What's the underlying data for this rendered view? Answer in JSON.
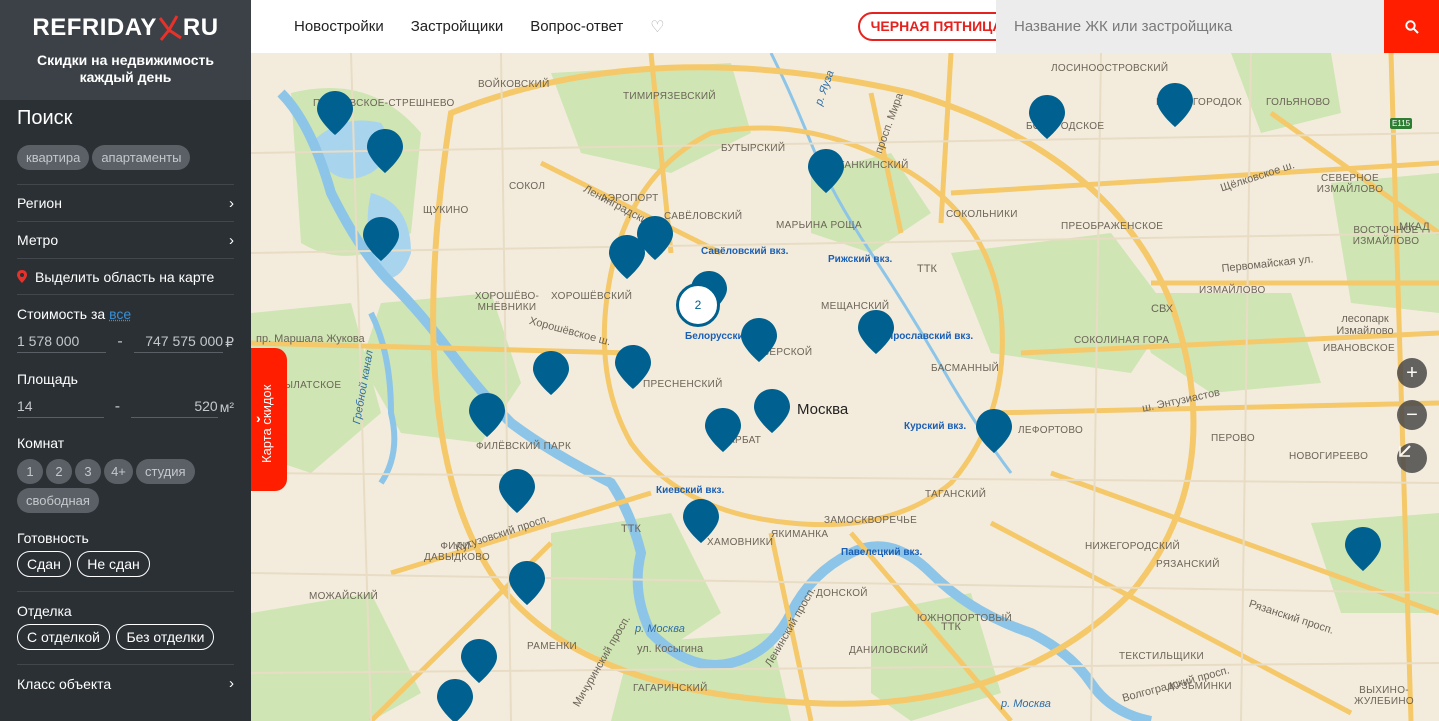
{
  "brand": {
    "logo_left": "REFRIDAY",
    "logo_right": "RU",
    "tagline": "Скидки на недвижимость каждый день"
  },
  "sidebar": {
    "title": "Поиск",
    "type_chips": [
      "квартира",
      "апартаменты"
    ],
    "region_label": "Регион",
    "metro_label": "Метро",
    "area_select_label": "Выделить область на карте",
    "price": {
      "label": "Стоимость за",
      "link": "все",
      "min": "1 578 000",
      "max": "747 575 000",
      "currency": "₽"
    },
    "area": {
      "label": "Площадь",
      "min": "14",
      "max": "520",
      "unit": "м²"
    },
    "rooms": {
      "label": "Комнат",
      "options": [
        "1",
        "2",
        "3",
        "4+"
      ],
      "extra": [
        "студия",
        "свободная"
      ]
    },
    "readiness": {
      "label": "Готовность",
      "options": [
        "Сдан",
        "Не сдан"
      ]
    },
    "finish": {
      "label": "Отделка",
      "options": [
        "С отделкой",
        "Без отделки"
      ]
    },
    "class_label": "Класс объекта"
  },
  "header": {
    "nav": [
      "Новостройки",
      "Застройщики",
      "Вопрос-ответ"
    ],
    "black_friday": "ЧЕРНАЯ ПЯТНИЦА",
    "search_placeholder": "Название ЖК или застройщика"
  },
  "map": {
    "discount_tab": "Карта скидок",
    "cluster_count": "2",
    "city_label": "Москва",
    "colors": {
      "marker": "#00608f",
      "accent": "#ff1e00",
      "sidebar": "#2b3035"
    },
    "labels": [
      "ПОКРОВСКОЕ-СТРЕШНЕВО",
      "ВОЙКОВСКИЙ",
      "ТИМИРЯЗЕВСКИЙ",
      "БУТЫРСКИЙ",
      "ОСТАНКИНСКИЙ",
      "ЛОСИНООСТРОВСКИЙ",
      "БОГОРОДСКОЕ",
      "МЕТРОГОРОДОК",
      "ГОЛЬЯНОВО",
      "СОКОЛ",
      "АЭРОПОРТ",
      "САВЁЛОВСКИЙ",
      "МАРЬИНА РОЩА",
      "СОКОЛЬНИКИ",
      "ПРЕОБРАЖЕНСКОЕ",
      "СЕВЕРНОЕ ИЗМАЙЛОВО",
      "ЩУКИНО",
      "ВОСТОЧНОЕ ИЗМАЙЛОВО",
      "ХОРОШЁВСКИЙ",
      "МЕЩАНСКИЙ",
      "ИЗМАЙЛОВО",
      "ХОРОШЁВО-МНЁВНИКИ",
      "СОКОЛИНАЯ ГОРА",
      "ИВАНОВСКОЕ",
      "КРЫЛАТСКОЕ",
      "ТВЕРСКОЙ",
      "БАСМАННЫЙ",
      "ПРЕСНЕНСКИЙ",
      "ЛЕФОРТОВО",
      "ФИЛЁВСКИЙ ПАРК",
      "АРБАТ",
      "ПЕРОВО",
      "НОВОГИРЕЕВО",
      "ТАГАНСКИЙ",
      "ЗАМОСКВОРЕЧЬЕ",
      "ХАМОВНИКИ",
      "ЯКИМАНКА",
      "ФИЛИ-ДАВЫДКОВО",
      "НИЖЕГОРОДСКИЙ",
      "РЯЗАНСКИЙ",
      "МОЖАЙСКИЙ",
      "ДОНСКОЙ",
      "ЮЖНОПОРТОВЫЙ",
      "РАМЕНКИ",
      "ДАНИЛОВСКИЙ",
      "ТЕКСТИЛЬЩИКИ",
      "ГАГАРИНСКИЙ",
      "ВЫХИНО-ЖУЛЕБИНО",
      "КУЗЬМИНКИ"
    ],
    "stations": [
      "Савёловский вкз.",
      "Рижский вкз.",
      "Белорусский вкз.",
      "Ярославский вкз.",
      "Курский вкз.",
      "Киевский вкз.",
      "Павелецкий вкз."
    ],
    "water": [
      "р. Москва",
      "р. Москва",
      "Гребной канал",
      "р. Яуза"
    ],
    "roads": [
      "пр. Маршала Жукова",
      "Ленинградский пр.",
      "Щёлковское ш.",
      "Первомайская ул.",
      "ш. Энтузиастов",
      "Кутузовский просп.",
      "Ленинский просп.",
      "Рязанский просп.",
      "Волгоградский просп.",
      "Хорошёвское ш.",
      "ул. Косыгина",
      "Мичуринский просп.",
      "просп. Мира",
      "лесопарк Измайлово"
    ],
    "road_short": [
      "ТТК",
      "СВХ",
      "МКАД",
      "Е115"
    ]
  }
}
